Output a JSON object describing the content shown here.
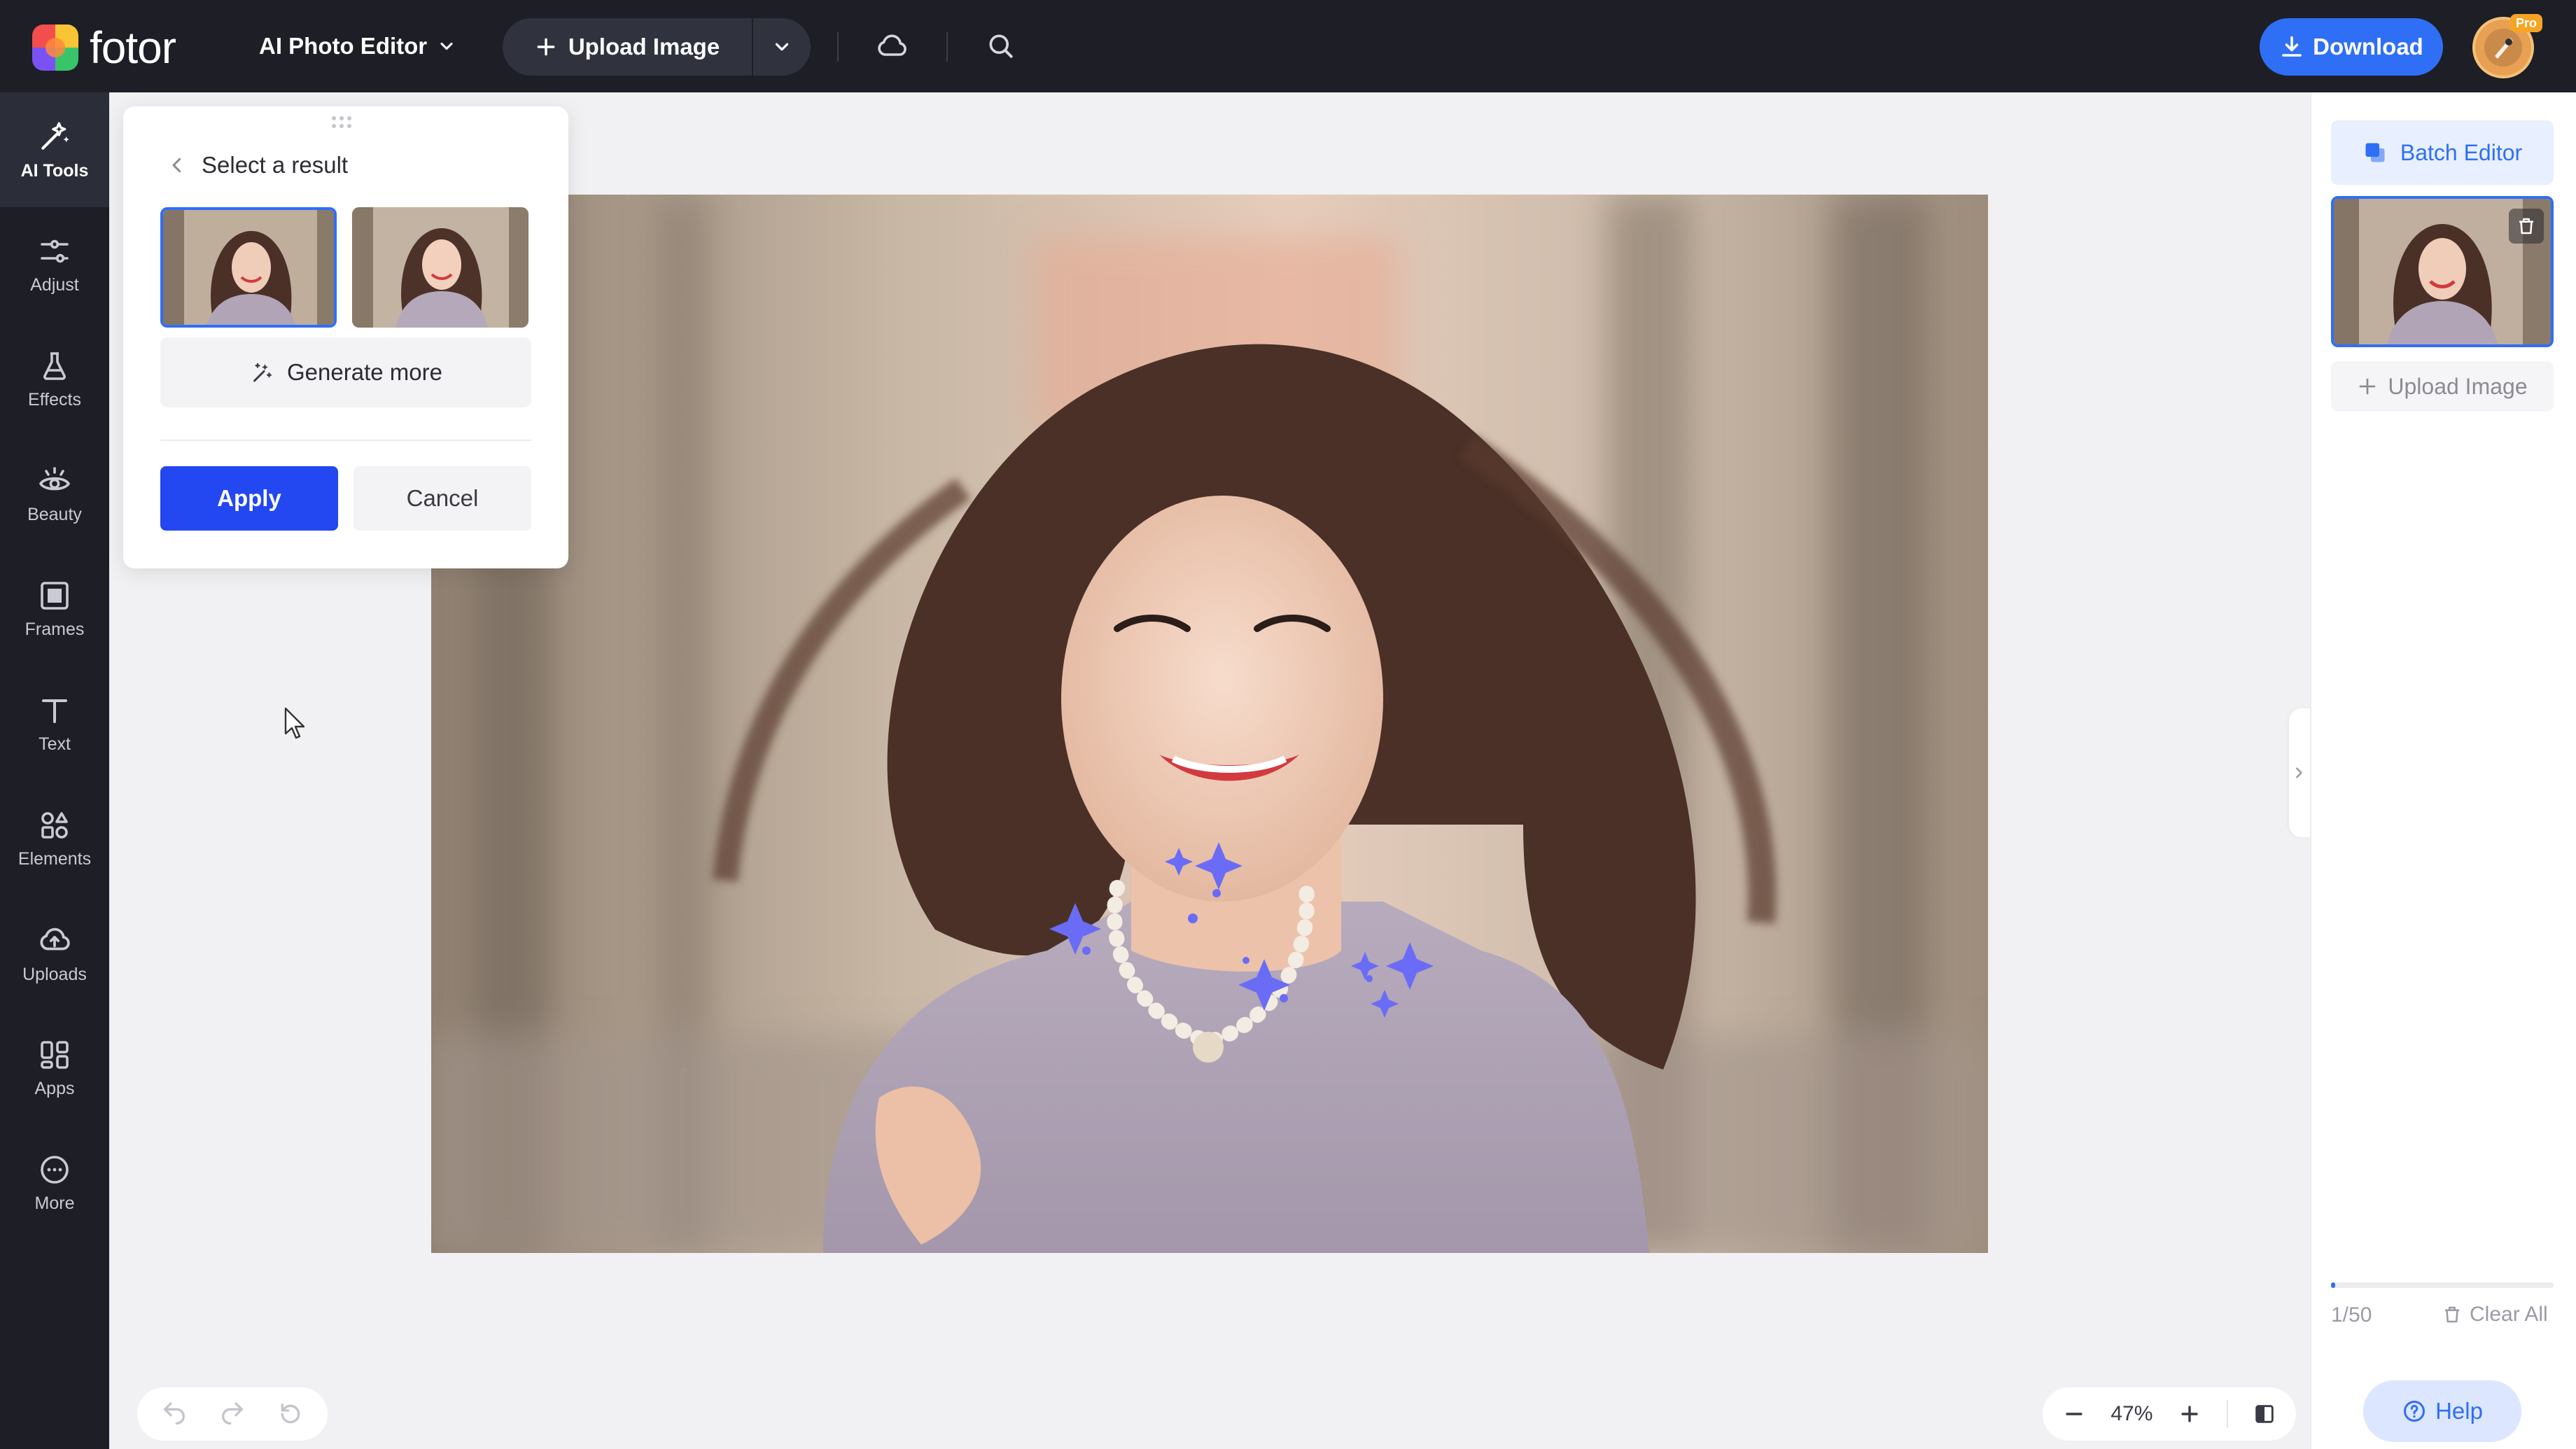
{
  "app": {
    "brand": "fotor"
  },
  "topbar": {
    "editor_menu": "AI Photo Editor",
    "upload_label": "Upload Image",
    "download_label": "Download",
    "pro_badge": "Pro",
    "icons": [
      "cloud-icon",
      "search-icon"
    ]
  },
  "sidebar": {
    "items": [
      {
        "label": "AI Tools",
        "icon": "ai-tools-icon",
        "active": true
      },
      {
        "label": "Adjust",
        "icon": "sliders-icon"
      },
      {
        "label": "Effects",
        "icon": "flask-icon"
      },
      {
        "label": "Beauty",
        "icon": "eye-icon"
      },
      {
        "label": "Frames",
        "icon": "frame-icon"
      },
      {
        "label": "Text",
        "icon": "text-icon"
      },
      {
        "label": "Elements",
        "icon": "shapes-icon"
      },
      {
        "label": "Uploads",
        "icon": "cloud-upload-icon"
      },
      {
        "label": "Apps",
        "icon": "apps-icon"
      },
      {
        "label": "More",
        "icon": "more-icon"
      }
    ]
  },
  "popup": {
    "title": "Select a result",
    "generate_more": "Generate more",
    "apply": "Apply",
    "cancel": "Cancel",
    "results": [
      {
        "selected": true
      },
      {
        "selected": false
      }
    ]
  },
  "right_panel": {
    "batch_editor": "Batch Editor",
    "upload_image": "Upload Image",
    "count": "1/50",
    "progress": 0.02,
    "clear_all": "Clear All",
    "help": "Help"
  },
  "zoom": {
    "level": "47%"
  },
  "colors": {
    "accent": "#2f6ff5",
    "apply": "#2347f0",
    "sparkle": "#6a6cf6",
    "chrome": "#1d1e26"
  }
}
